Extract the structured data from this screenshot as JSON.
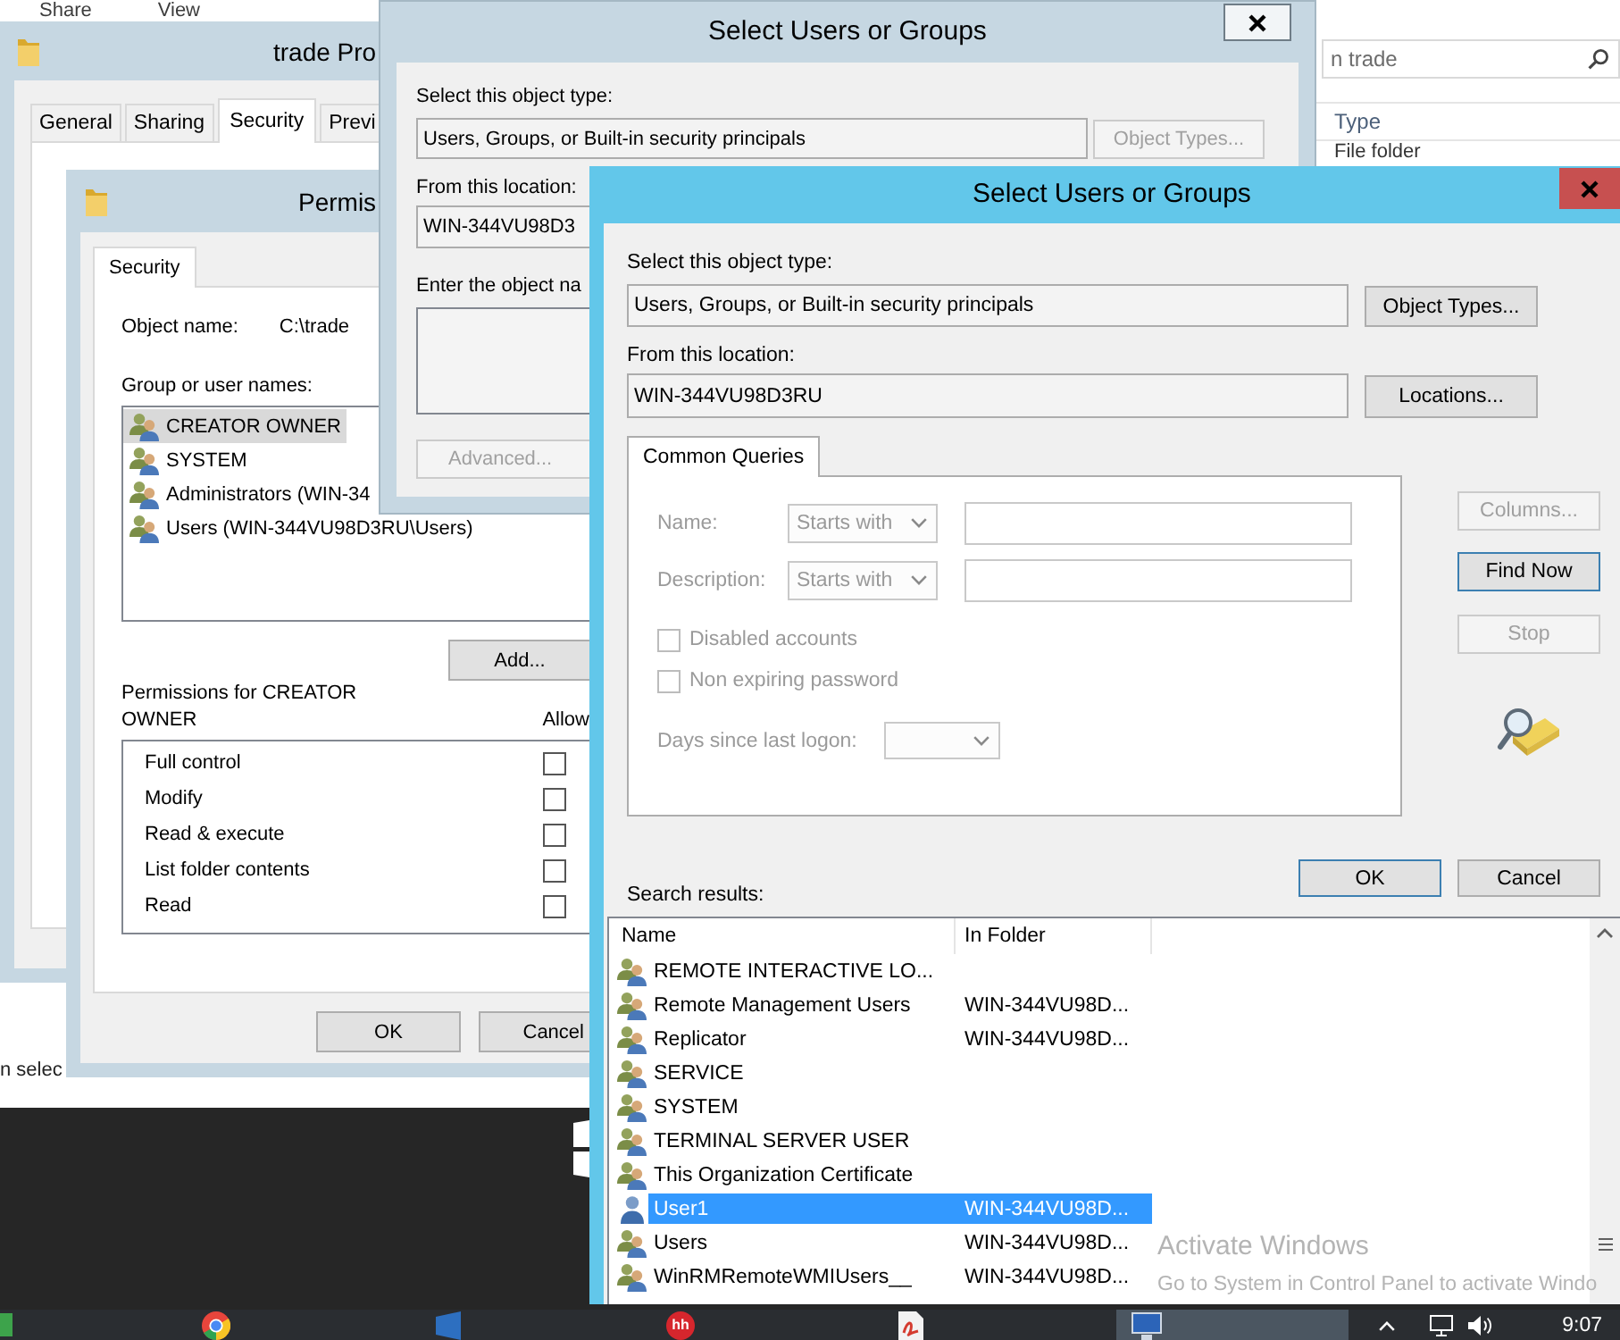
{
  "explorer": {
    "ribbon_tabs": [
      "Share",
      "View"
    ],
    "search": {
      "placeholder": "n trade"
    },
    "columns": [
      "Type"
    ],
    "rows": [
      "File folder"
    ],
    "status_bar": "n selec"
  },
  "properties_window": {
    "title": "trade Pro",
    "tabs": [
      {
        "label": "General",
        "selected": false
      },
      {
        "label": "Sharing",
        "selected": false
      },
      {
        "label": "Security",
        "selected": true
      },
      {
        "label": "Previ",
        "selected": false
      }
    ]
  },
  "permissions_window": {
    "title": "Permis",
    "tabs": [
      {
        "label": "Security",
        "selected": true
      }
    ],
    "object_name_label": "Object name:",
    "object_name": "C:\\trade",
    "group_label": "Group or user names:",
    "groups": [
      {
        "name": "CREATOR OWNER",
        "selected": true
      },
      {
        "name": "SYSTEM",
        "selected": false
      },
      {
        "name": "Administrators (WIN-34",
        "selected": false
      },
      {
        "name": "Users (WIN-344VU98D3RU\\Users)",
        "selected": false
      }
    ],
    "add_button": "Add...",
    "permissions_label": "Permissions for CREATOR OWNER",
    "allow_column": "Allow",
    "permissions": [
      {
        "name": "Full control",
        "checked": false
      },
      {
        "name": "Modify",
        "checked": false
      },
      {
        "name": "Read & execute",
        "checked": false
      },
      {
        "name": "List folder contents",
        "checked": false
      },
      {
        "name": "Read",
        "checked": false
      }
    ],
    "buttons": [
      "OK",
      "Cancel"
    ]
  },
  "back_dialog": {
    "title": "Select Users or Groups",
    "object_type_label": "Select this object type:",
    "object_type": "Users, Groups, or Built-in security principals",
    "object_types_button": {
      "label": "Object Types...",
      "disabled": true
    },
    "location_label": "From this location:",
    "location": "WIN-344VU98D3",
    "names_label": "Enter the object na",
    "advanced_button": {
      "label": "Advanced...",
      "disabled": true
    }
  },
  "front_dialog": {
    "title": "Select Users or Groups",
    "object_type_label": "Select this object type:",
    "object_type": "Users, Groups, or Built-in security principals",
    "object_types_button": {
      "label": "Object Types...",
      "disabled": false
    },
    "location_label": "From this location:",
    "location": "WIN-344VU98D3RU",
    "locations_button": {
      "label": "Locations...",
      "disabled": false
    },
    "tabs": [
      {
        "label": "Common Queries",
        "selected": true
      }
    ],
    "query": {
      "disabled": true,
      "name_label": "Name:",
      "name_match": "Starts with",
      "description_label": "Description:",
      "description_match": "Starts with",
      "checkboxes": [
        {
          "label": "Disabled accounts",
          "checked": false
        },
        {
          "label": "Non expiring password",
          "checked": false
        }
      ],
      "days_label": "Days since last logon:"
    },
    "side_buttons": [
      {
        "label": "Columns...",
        "disabled": true,
        "default": false
      },
      {
        "label": "Find Now",
        "disabled": false,
        "default": true
      },
      {
        "label": "Stop",
        "disabled": true,
        "default": false
      }
    ],
    "buttons": [
      {
        "label": "OK",
        "default": true
      },
      {
        "label": "Cancel",
        "default": false
      }
    ],
    "results_label": "Search results:",
    "results": {
      "columns": [
        "Name",
        "In Folder"
      ],
      "rows": [
        {
          "kind": "group",
          "name": "REMOTE INTERACTIVE LO...",
          "selected": false
        },
        {
          "kind": "group",
          "name": "Remote Management Users",
          "folder": "WIN-344VU98D...",
          "selected": false
        },
        {
          "kind": "group",
          "name": "Replicator",
          "folder": "WIN-344VU98D...",
          "selected": false
        },
        {
          "kind": "group",
          "name": "SERVICE",
          "selected": false
        },
        {
          "kind": "group",
          "name": "SYSTEM",
          "selected": false
        },
        {
          "kind": "group",
          "name": "TERMINAL SERVER USER",
          "selected": false
        },
        {
          "kind": "group",
          "name": "This Organization Certificate",
          "selected": false
        },
        {
          "kind": "user",
          "name": "User1",
          "folder": "WIN-344VU98D...",
          "selected": true
        },
        {
          "kind": "group",
          "name": "Users",
          "folder": "WIN-344VU98D...",
          "selected": false
        },
        {
          "kind": "group",
          "name": "WinRMRemoteWMIUsers__",
          "folder": "WIN-344VU98D...",
          "selected": false
        }
      ]
    }
  },
  "activation_notice": {
    "title": "Activate Windows",
    "text": "Go to System in Control Panel to activate Windo"
  },
  "taskbar": {
    "items": [
      {
        "kind": "square",
        "active": false
      },
      {
        "kind": "ring",
        "active": false
      },
      {
        "kind": "tile",
        "active": false
      },
      {
        "kind": "disc",
        "badge": "hh",
        "active": false
      },
      {
        "kind": "document",
        "active": false
      },
      {
        "kind": "monitor",
        "active": true
      }
    ],
    "clock": "9:07"
  }
}
